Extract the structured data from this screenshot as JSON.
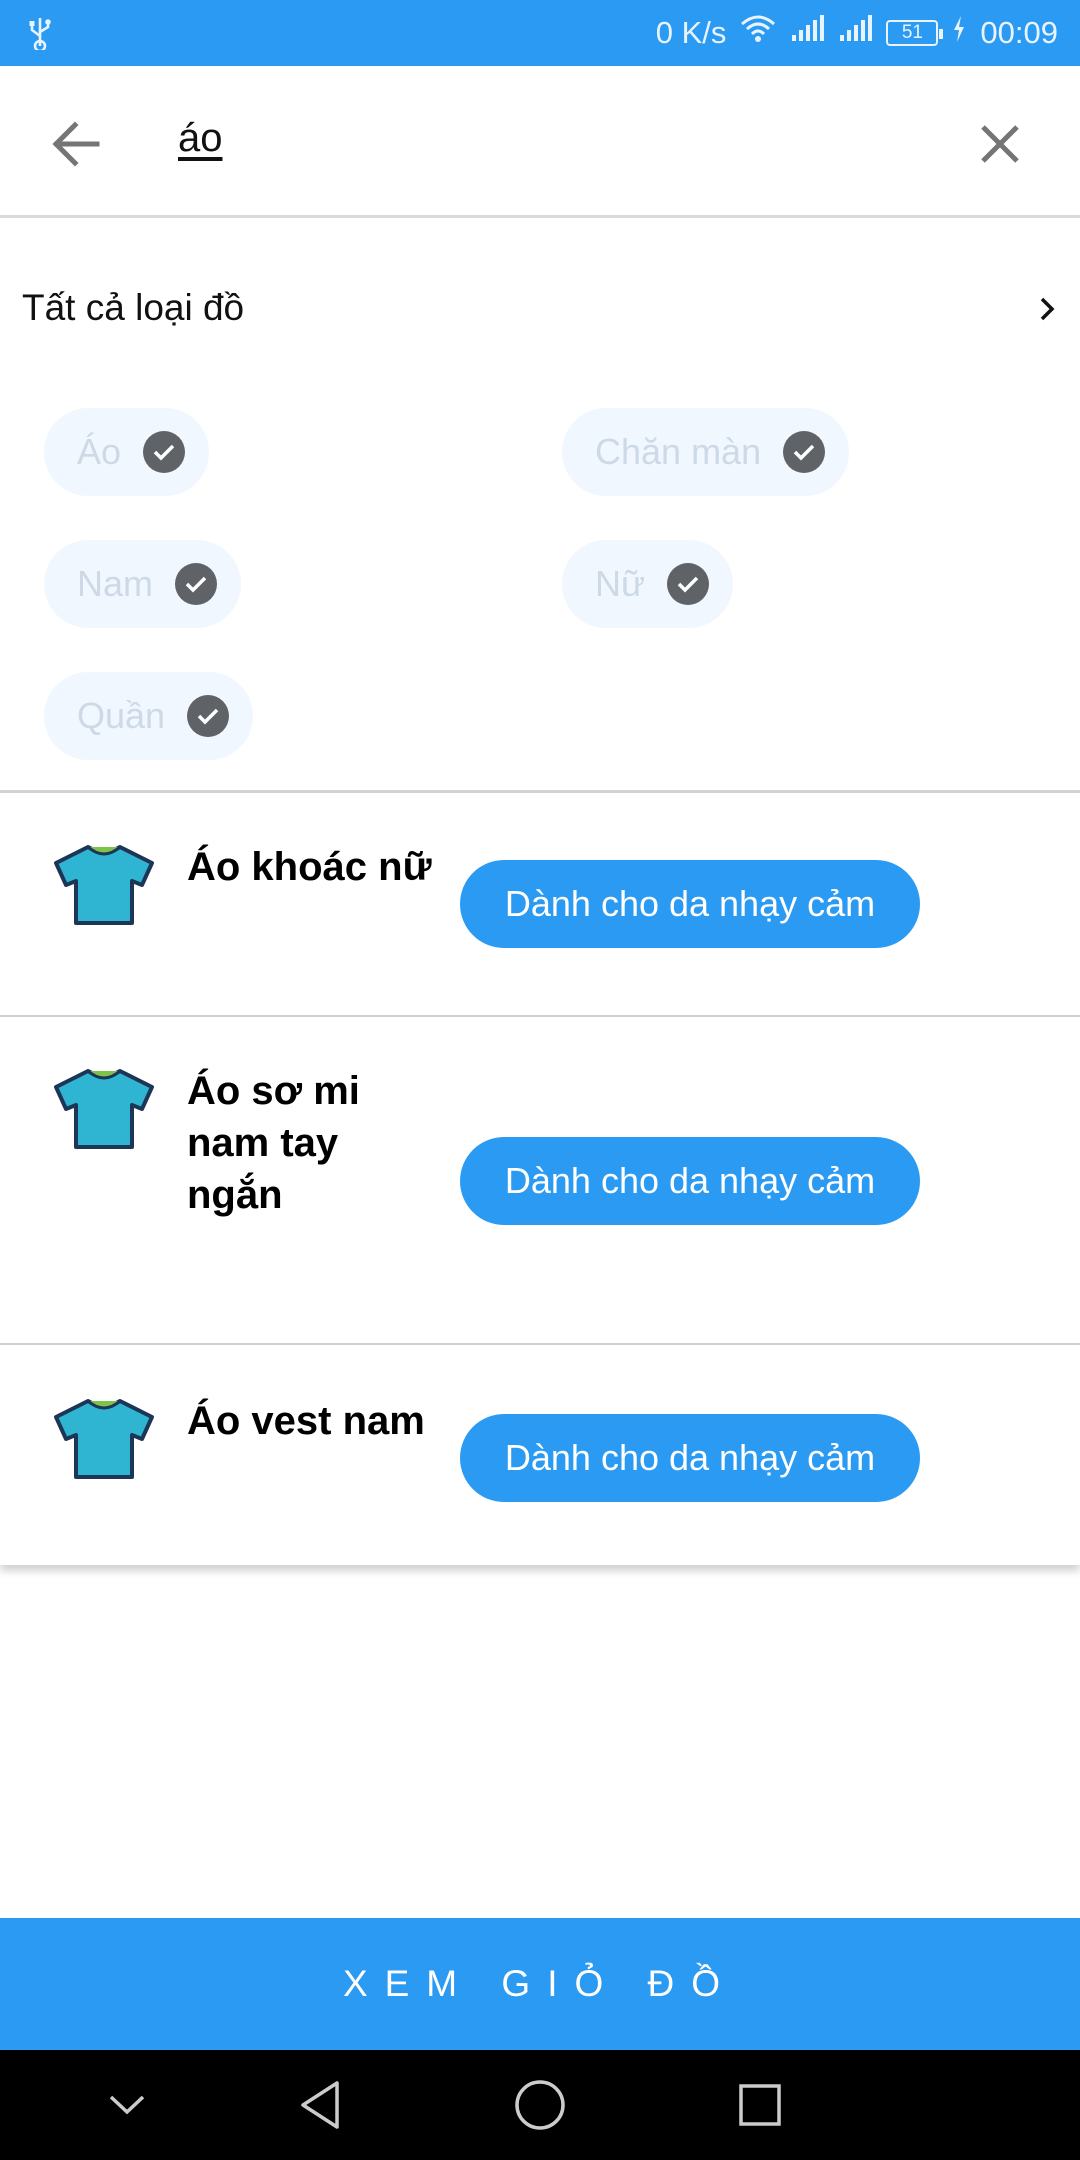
{
  "status_bar": {
    "speed": "0 K/s",
    "battery": "51",
    "time": "00:09"
  },
  "search": {
    "query": "áo"
  },
  "category": {
    "label": "Tất cả loại đồ"
  },
  "filters": [
    {
      "label": "Áo",
      "selected": true
    },
    {
      "label": "Chăn màn",
      "selected": true
    },
    {
      "label": "Nam",
      "selected": true
    },
    {
      "label": "Nữ",
      "selected": true
    },
    {
      "label": "Quần",
      "selected": true
    }
  ],
  "products": [
    {
      "name": "Áo khoác nữ",
      "tag": "Dành cho da nhạy cảm",
      "icon": "shirt-icon"
    },
    {
      "name": "Áo sơ mi nam tay ngắn",
      "tag": "Dành cho da nhạy cảm",
      "icon": "shirt-icon"
    },
    {
      "name": "Áo vest nam",
      "tag": "Dành cho da nhạy cảm",
      "icon": "shirt-icon"
    }
  ],
  "footer": {
    "cart_button": "XEM GIỎ ĐỒ"
  },
  "colors": {
    "primary": "#2b9af3",
    "chip_bg": "#f0f7ff",
    "check": "#5f6368",
    "shirt": "#2fb5d2"
  }
}
